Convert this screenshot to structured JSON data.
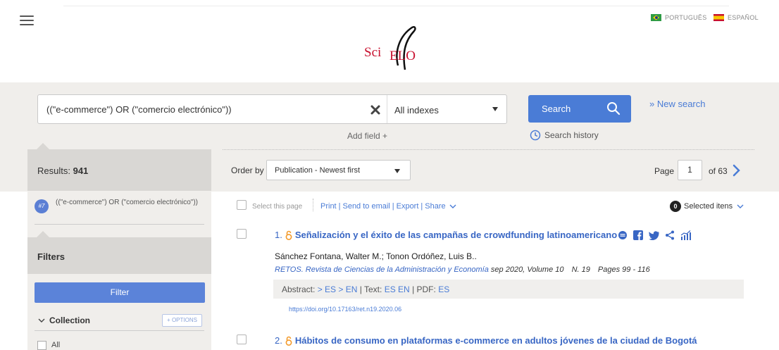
{
  "header": {
    "languages": [
      {
        "label": "PORTUGUÊS",
        "flag": "brazil-flag-icon"
      },
      {
        "label": "ESPAÑOL",
        "flag": "spain-flag-icon"
      }
    ],
    "logo_text": "SciELO"
  },
  "search": {
    "query": "((\"e-commerce\") OR (\"comercio electrónico\"))",
    "index": "All indexes",
    "search_button": "Search",
    "new_search": "» New search",
    "add_field": "Add field +",
    "search_history": "Search history"
  },
  "sidebar": {
    "results_label": "Results:",
    "results_count": "941",
    "history": {
      "badge": "#7",
      "query": "((\"e-commerce\") OR (\"comercio electrónico\"))"
    },
    "filters_label": "Filters",
    "filter_button": "Filter",
    "collection_label": "Collection",
    "options_button": "+ OPTIONS",
    "collection_items": [
      "All"
    ]
  },
  "toolbar": {
    "order_by_label": "Order by",
    "order_value": "Publication - Newest first",
    "page_label": "Page",
    "page_value": "1",
    "page_total": "of 63",
    "select_page": "Select this page",
    "actions": [
      "Print",
      "Send to email",
      "Export",
      "Share"
    ],
    "selected_count": "0",
    "selected_label": "Selected itens"
  },
  "results": [
    {
      "number": "1.",
      "title": "Señalización y el éxito de las campañas de crowdfunding latinoamericano",
      "authors": "Sánchez Fontana, Walter M.; Tonon Ordóñez, Luis B..",
      "journal": "RETOS. Revista de Ciencias de la Administración y Economía",
      "date": "sep 2020,",
      "volume": "Volume 10",
      "issue": "N. 19",
      "pages": "Pages 99 - 116",
      "abstract_label": "Abstract:",
      "abstract_links": [
        "> ES",
        "> EN"
      ],
      "text_label": "Text:",
      "text_links": [
        "ES",
        "EN"
      ],
      "pdf_label": "PDF:",
      "pdf_links": [
        "ES"
      ],
      "doi": "https://doi.org/10.17163/ret.n19.2020.06"
    },
    {
      "number": "2.",
      "title": "Hábitos de consumo en plataformas e-commerce en adultos jóvenes de la ciudad de Bogotá"
    }
  ],
  "colors": {
    "accent": "#4a7cd6",
    "title_link": "#3866c4",
    "open_access": "#f39a2b",
    "band": "#f0eeeb",
    "panel_header": "#d9d7d4"
  }
}
